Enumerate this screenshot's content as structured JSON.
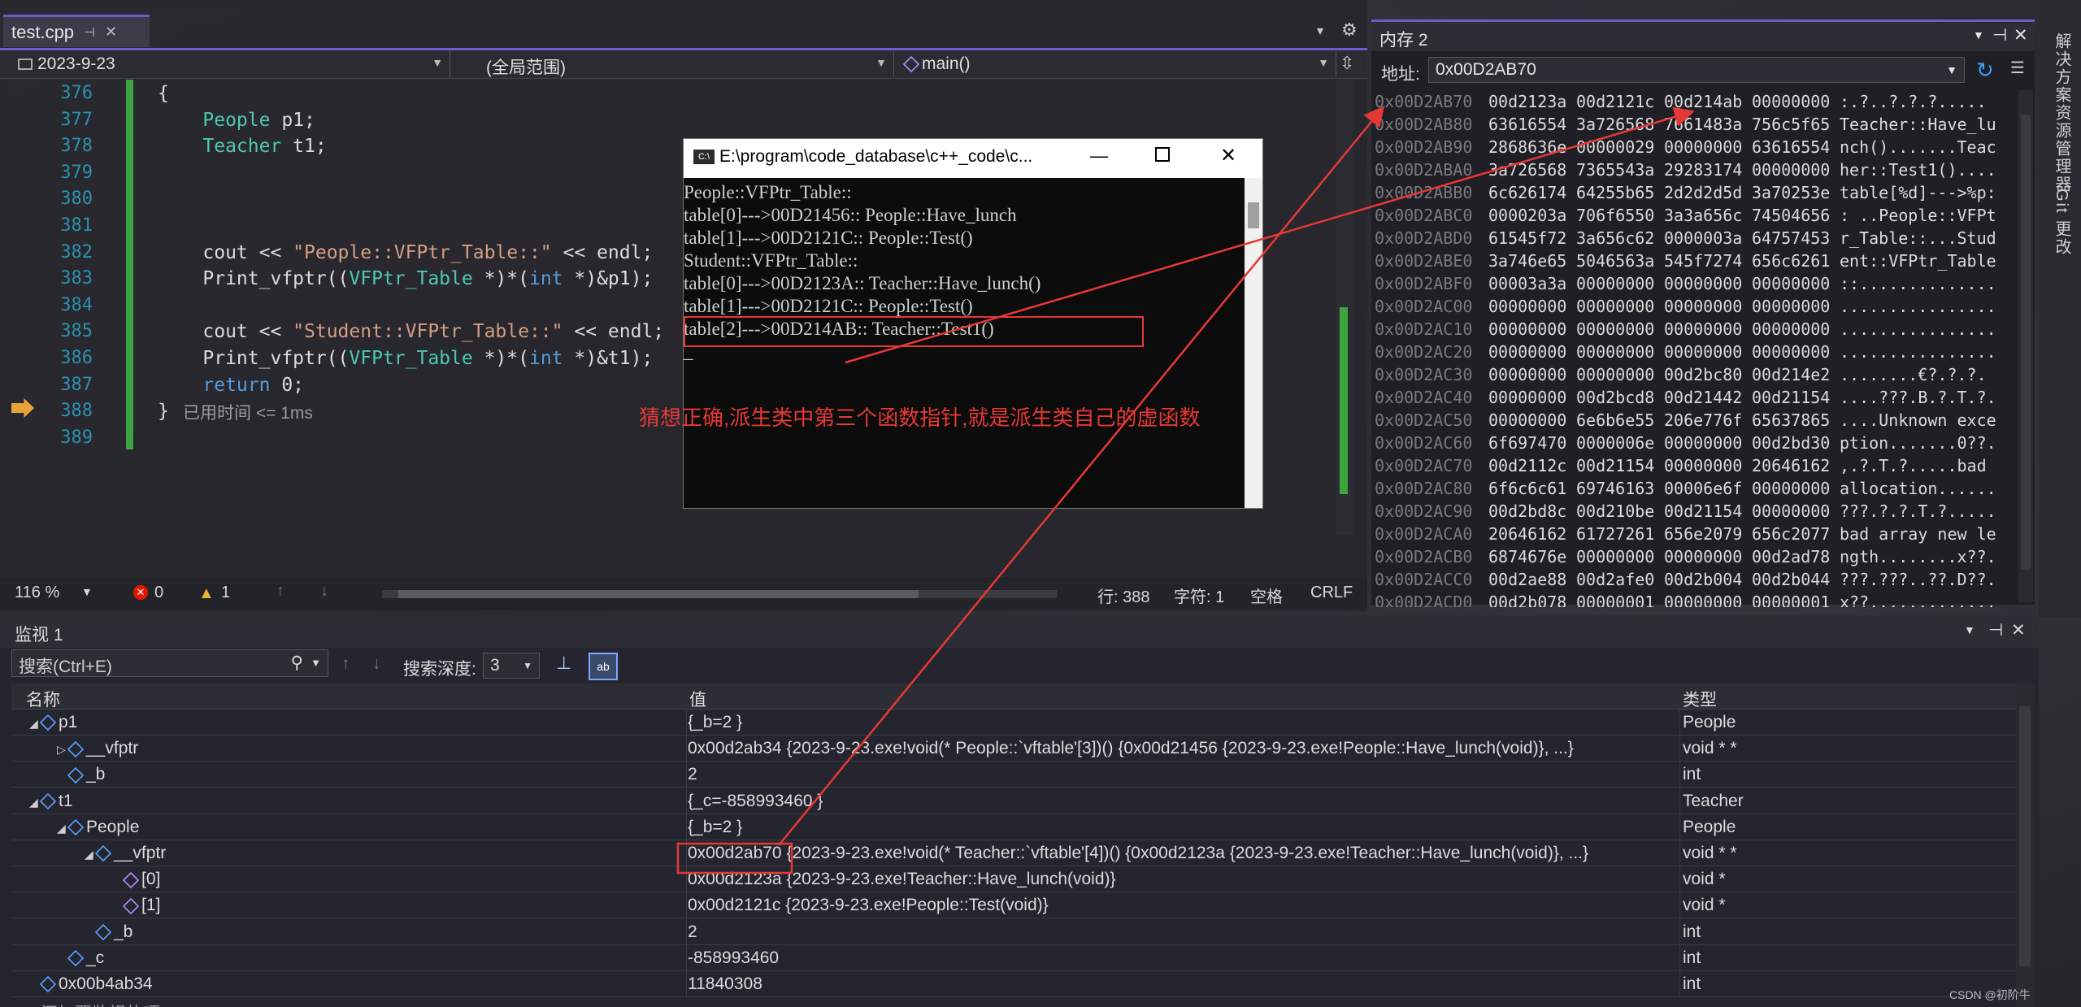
{
  "editor": {
    "tab_name": "test.cpp",
    "tab_pin": "⊣",
    "tab_close": "✕",
    "tab_menu": "▾",
    "settings": "⚙",
    "nav_project": "2023-9-23",
    "nav_scope": "(全局范围)",
    "nav_func": "main()",
    "lines": [
      {
        "num": "376",
        "parts": [
          {
            "t": "{",
            "c": "pl"
          }
        ]
      },
      {
        "num": "377",
        "parts": [
          {
            "t": "    People",
            "c": "ty"
          },
          {
            "t": " p1;",
            "c": "pl"
          }
        ]
      },
      {
        "num": "378",
        "parts": [
          {
            "t": "    Teacher",
            "c": "ty"
          },
          {
            "t": " t1;",
            "c": "pl"
          }
        ]
      },
      {
        "num": "379",
        "parts": []
      },
      {
        "num": "380",
        "parts": []
      },
      {
        "num": "381",
        "parts": []
      },
      {
        "num": "382",
        "parts": [
          {
            "t": "    cout << ",
            "c": "pl"
          },
          {
            "t": "\"People::VFPtr_Table::\"",
            "c": "st"
          },
          {
            "t": " << endl;",
            "c": "pl"
          }
        ]
      },
      {
        "num": "383",
        "parts": [
          {
            "t": "    Print_vfptr((",
            "c": "pl"
          },
          {
            "t": "VFPtr_Table",
            "c": "ty"
          },
          {
            "t": " *)*(",
            "c": "pl"
          },
          {
            "t": "int",
            "c": "kw"
          },
          {
            "t": " *)&p1);",
            "c": "pl"
          }
        ]
      },
      {
        "num": "384",
        "parts": []
      },
      {
        "num": "385",
        "parts": [
          {
            "t": "    cout << ",
            "c": "pl"
          },
          {
            "t": "\"Student::VFPtr_Table::\"",
            "c": "st"
          },
          {
            "t": " << endl;",
            "c": "pl"
          }
        ]
      },
      {
        "num": "386",
        "parts": [
          {
            "t": "    Print_vfptr((",
            "c": "pl"
          },
          {
            "t": "VFPtr_Table",
            "c": "ty"
          },
          {
            "t": " *)*(",
            "c": "pl"
          },
          {
            "t": "int",
            "c": "kw"
          },
          {
            "t": " *)&t1);",
            "c": "pl"
          }
        ]
      },
      {
        "num": "387",
        "parts": [
          {
            "t": "    return",
            "c": "kw"
          },
          {
            "t": " 0;",
            "c": "pl"
          }
        ]
      },
      {
        "num": "388",
        "parts": [
          {
            "t": "}",
            "c": "pl"
          }
        ]
      },
      {
        "num": "389",
        "parts": []
      }
    ],
    "elapsed": "已用时间 <= 1ms",
    "status": {
      "zoom": "116 %",
      "errors": "0",
      "warnings": "1",
      "line": "行: 388",
      "col": "字符: 1",
      "spaces": "空格",
      "eol": "CRLF"
    }
  },
  "memory": {
    "title": "内存 2",
    "addr_label": "地址:",
    "addr_value": "0x00D2AB70",
    "rows": [
      {
        "a": "0x00D2AB70",
        "b": [
          "00d2123a",
          "00d2121c",
          "00d214ab",
          "00000000"
        ],
        "c": ":.?..?.?.?....."
      },
      {
        "a": "0x00D2AB80",
        "b": [
          "63616554",
          "3a726568",
          "7661483a",
          "756c5f65"
        ],
        "c": "Teacher::Have_lu"
      },
      {
        "a": "0x00D2AB90",
        "b": [
          "2868636e",
          "00000029",
          "00000000",
          "63616554"
        ],
        "c": "nch().......Teac"
      },
      {
        "a": "0x00D2ABA0",
        "b": [
          "3a726568",
          "7365543a",
          "29283174",
          "00000000"
        ],
        "c": "her::Test1()...."
      },
      {
        "a": "0x00D2ABB0",
        "b": [
          "6c626174",
          "64255b65",
          "2d2d2d5d",
          "3a70253e"
        ],
        "c": "table[%d]--->%p:"
      },
      {
        "a": "0x00D2ABC0",
        "b": [
          "0000203a",
          "706f6550",
          "3a3a656c",
          "74504656"
        ],
        "c": ": ..People::VFPt"
      },
      {
        "a": "0x00D2ABD0",
        "b": [
          "61545f72",
          "3a656c62",
          "0000003a",
          "64757453"
        ],
        "c": "r_Table::...Stud"
      },
      {
        "a": "0x00D2ABE0",
        "b": [
          "3a746e65",
          "5046563a",
          "545f7274",
          "656c6261"
        ],
        "c": "ent::VFPtr_Table"
      },
      {
        "a": "0x00D2ABF0",
        "b": [
          "00003a3a",
          "00000000",
          "00000000",
          "00000000"
        ],
        "c": "::.............."
      },
      {
        "a": "0x00D2AC00",
        "b": [
          "00000000",
          "00000000",
          "00000000",
          "00000000"
        ],
        "c": "................"
      },
      {
        "a": "0x00D2AC10",
        "b": [
          "00000000",
          "00000000",
          "00000000",
          "00000000"
        ],
        "c": "................"
      },
      {
        "a": "0x00D2AC20",
        "b": [
          "00000000",
          "00000000",
          "00000000",
          "00000000"
        ],
        "c": "................"
      },
      {
        "a": "0x00D2AC30",
        "b": [
          "00000000",
          "00000000",
          "00d2bc80",
          "00d214e2"
        ],
        "c": "........€?.?.?."
      },
      {
        "a": "0x00D2AC40",
        "b": [
          "00000000",
          "00d2bcd8",
          "00d21442",
          "00d21154"
        ],
        "c": "....???.B.?.T.?."
      },
      {
        "a": "0x00D2AC50",
        "b": [
          "00000000",
          "6e6b6e55",
          "206e776f",
          "65637865"
        ],
        "c": "....Unknown exce"
      },
      {
        "a": "0x00D2AC60",
        "b": [
          "6f697470",
          "0000006e",
          "00000000",
          "00d2bd30"
        ],
        "c": "ption.......0??."
      },
      {
        "a": "0x00D2AC70",
        "b": [
          "00d2112c",
          "00d21154",
          "00000000",
          "20646162"
        ],
        "c": ",.?.T.?.....bad "
      },
      {
        "a": "0x00D2AC80",
        "b": [
          "6f6c6c61",
          "69746163",
          "00006e6f",
          "00000000"
        ],
        "c": "allocation......"
      },
      {
        "a": "0x00D2AC90",
        "b": [
          "00d2bd8c",
          "00d210be",
          "00d21154",
          "00000000"
        ],
        "c": "???.?.?.T.?....."
      },
      {
        "a": "0x00D2ACA0",
        "b": [
          "20646162",
          "61727261",
          "656e2079",
          "656c2077"
        ],
        "c": "bad array new le"
      },
      {
        "a": "0x00D2ACB0",
        "b": [
          "6874676e",
          "00000000",
          "00000000",
          "00d2ad78"
        ],
        "c": "ngth........x??."
      },
      {
        "a": "0x00D2ACC0",
        "b": [
          "00d2ae88",
          "00d2afe0",
          "00d2b004",
          "00d2b044"
        ],
        "c": "???.???..??.D??."
      },
      {
        "a": "0x00D2ACD0",
        "b": [
          "00d2b078",
          "00000001",
          "00000000",
          "00000001"
        ],
        "c": "x??............."
      }
    ]
  },
  "side": {
    "solution_explorer": "解决方案资源管理器",
    "git_changes": "Git 更改"
  },
  "console": {
    "title": "E:\\program\\code_database\\c++_code\\c...",
    "lines": [
      "People::VFPtr_Table::",
      "table[0]--->00D21456:: People::Have_lunch",
      "table[1]--->00D2121C:: People::Test()",
      "Student::VFPtr_Table::",
      "table[0]--->00D2123A:: Teacher::Have_lunch()",
      "table[1]--->00D2121C:: People::Test()",
      "table[2]--->00D214AB:: Teacher::Test1()"
    ],
    "cursor": "_"
  },
  "annotation": {
    "text": "猜想正确,派生类中第三个函数指针,就是派生类自己的虚函数",
    "color": "#e53935"
  },
  "watch": {
    "title": "监视 1",
    "search_placeholder": "搜索(Ctrl+E)",
    "depth_label": "搜索深度:",
    "depth_value": "3",
    "col_name": "名称",
    "col_value": "值",
    "col_type": "类型",
    "rows": [
      {
        "indent": 0,
        "arrow": "◢",
        "icon": "blue",
        "name": "p1",
        "value": "{_b=2 }",
        "type": "People"
      },
      {
        "indent": 1,
        "arrow": "▷",
        "icon": "blue",
        "name": "__vfptr",
        "value": "0x00d2ab34 {2023-9-23.exe!void(* People::`vftable'[3])() {0x00d21456 {2023-9-23.exe!People::Have_lunch(void)}, ...}",
        "type": "void * *"
      },
      {
        "indent": 1,
        "arrow": "",
        "icon": "blue",
        "name": "_b",
        "value": "2",
        "type": "int"
      },
      {
        "indent": 0,
        "arrow": "◢",
        "icon": "blue",
        "name": "t1",
        "value": "{_c=-858993460 }",
        "type": "Teacher"
      },
      {
        "indent": 1,
        "arrow": "◢",
        "icon": "blue",
        "name": "People",
        "value": "{_b=2 }",
        "type": "People"
      },
      {
        "indent": 2,
        "arrow": "◢",
        "icon": "blue",
        "name": "__vfptr",
        "value": "0x00d2ab70 {2023-9-23.exe!void(* Teacher::`vftable'[4])() {0x00d2123a {2023-9-23.exe!Teacher::Have_lunch(void)}, ...}",
        "type": "void * *"
      },
      {
        "indent": 3,
        "arrow": "",
        "icon": "purple",
        "name": "[0]",
        "value": "0x00d2123a {2023-9-23.exe!Teacher::Have_lunch(void)}",
        "type": "void *"
      },
      {
        "indent": 3,
        "arrow": "",
        "icon": "purple",
        "name": "[1]",
        "value": "0x00d2121c {2023-9-23.exe!People::Test(void)}",
        "type": "void *"
      },
      {
        "indent": 2,
        "arrow": "",
        "icon": "blue",
        "name": "_b",
        "value": "2",
        "type": "int"
      },
      {
        "indent": 1,
        "arrow": "",
        "icon": "blue",
        "name": "_c",
        "value": "-858993460",
        "type": "int"
      },
      {
        "indent": 0,
        "arrow": "",
        "icon": "blue",
        "name": "0x00b4ab34",
        "value": "11840308",
        "type": "int"
      }
    ],
    "add_item": "添加要监视的项"
  },
  "watermark": "CSDN @初阶牛"
}
